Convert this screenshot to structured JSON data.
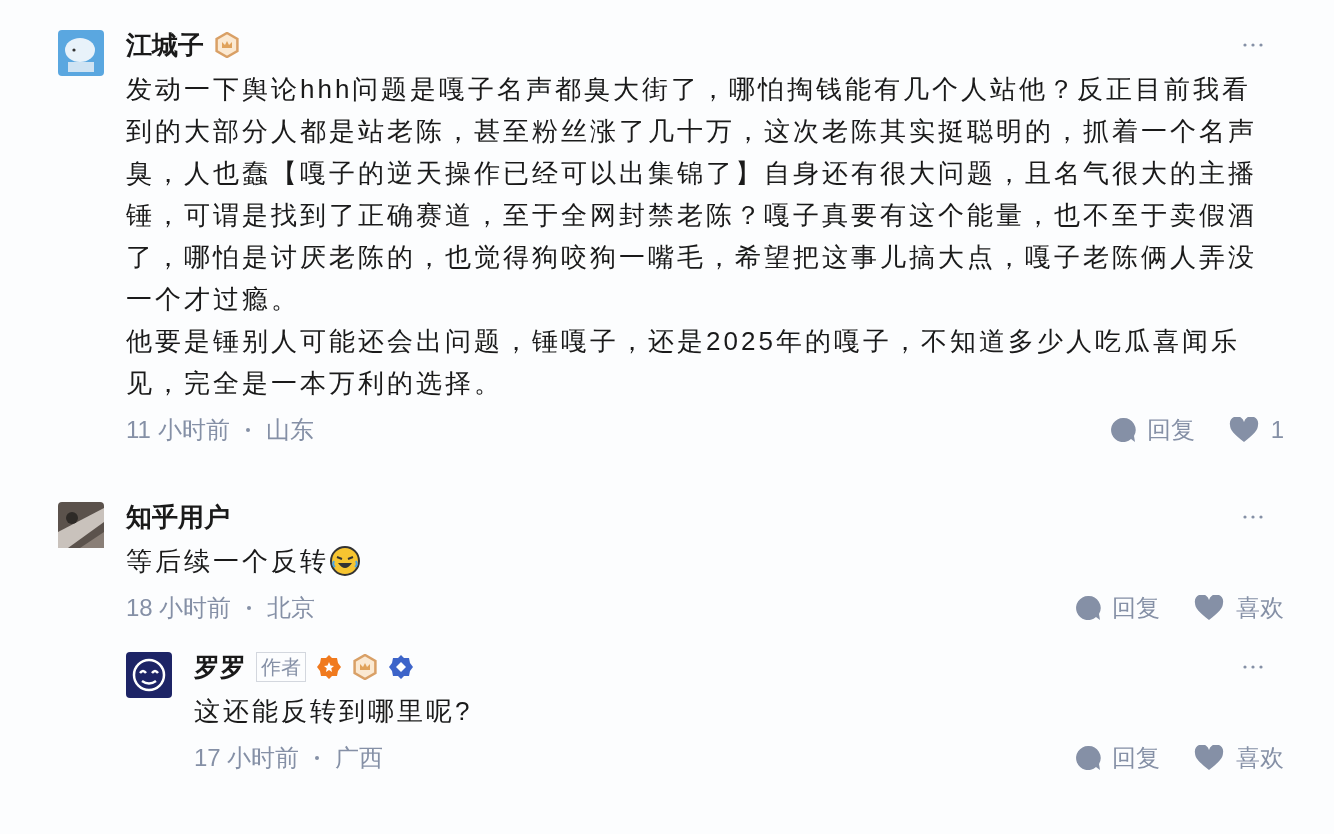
{
  "comments": [
    {
      "author": "江城子",
      "avatar": {
        "kind": "cartoon"
      },
      "badges": [
        {
          "kind": "crown"
        }
      ],
      "paragraphs": [
        "发动一下舆论hhh问题是嘎子名声都臭大街了，哪怕掏钱能有几个人站他？反正目前我看到的大部分人都是站老陈，甚至粉丝涨了几十万，这次老陈其实挺聪明的，抓着一个名声臭，人也蠢【嘎子的逆天操作已经可以出集锦了】自身还有很大问题，且名气很大的主播锤，可谓是找到了正确赛道，至于全网封禁老陈？嘎子真要有这个能量，也不至于卖假酒了，哪怕是讨厌老陈的，也觉得狗咬狗一嘴毛，希望把这事儿搞大点，嘎子老陈俩人弄没一个才过瘾。",
        "他要是锤别人可能还会出问题，锤嘎子，还是2025年的嘎子，不知道多少人吃瓜喜闻乐见，完全是一本万利的选择。"
      ],
      "emoji": false,
      "time": "11 小时前",
      "location": "山东",
      "reply_label": "回复",
      "like_label": "1"
    },
    {
      "author": "知乎用户",
      "avatar": {
        "kind": "photo"
      },
      "paragraphs": [
        "等后续一个反转"
      ],
      "emoji": true,
      "time": "18 小时前",
      "location": "北京",
      "reply_label": "回复",
      "like_label": "喜欢",
      "replies": [
        {
          "author": "罗罗",
          "avatar": {
            "kind": "face"
          },
          "tag": "作者",
          "badges": [
            {
              "kind": "star"
            },
            {
              "kind": "crown"
            },
            {
              "kind": "diamond"
            }
          ],
          "paragraphs": [
            "这还能反转到哪里呢?"
          ],
          "emoji": false,
          "time": "17 小时前",
          "location": "广西",
          "reply_label": "回复",
          "like_label": "喜欢"
        }
      ]
    }
  ]
}
